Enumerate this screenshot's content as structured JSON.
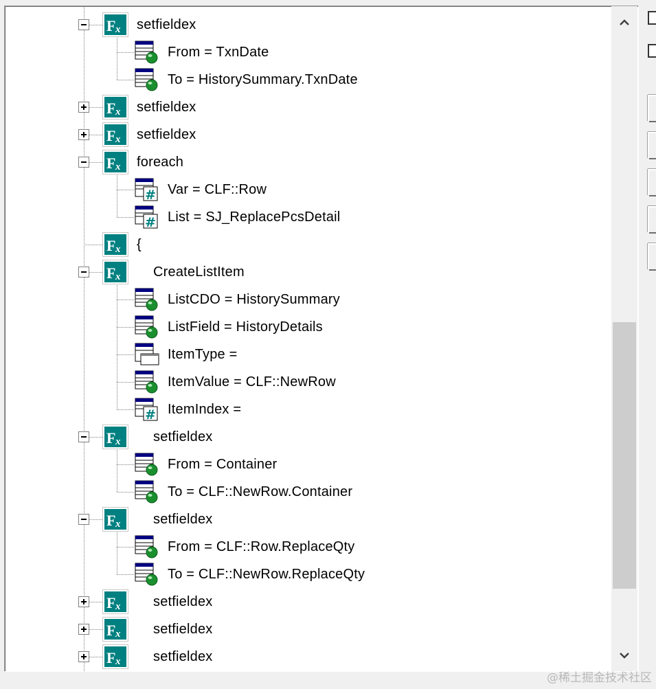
{
  "tree": {
    "rows": [
      {
        "label": "setfieldex",
        "icon": "function-icon",
        "expander": "minus"
      },
      {
        "label": "From = TxnDate",
        "icon": "table-globe-icon",
        "expander": ""
      },
      {
        "label": "To = HistorySummary.TxnDate",
        "icon": "table-globe-icon",
        "expander": ""
      },
      {
        "label": "setfieldex",
        "icon": "function-icon",
        "expander": "plus"
      },
      {
        "label": "setfieldex",
        "icon": "function-icon",
        "expander": "plus"
      },
      {
        "label": "foreach",
        "icon": "function-icon",
        "expander": "minus"
      },
      {
        "label": "Var = CLF::Row",
        "icon": "table-hash-icon",
        "expander": ""
      },
      {
        "label": "List = SJ_ReplacePcsDetail",
        "icon": "table-hash-icon",
        "expander": ""
      },
      {
        "label": "{",
        "icon": "function-icon",
        "expander": ""
      },
      {
        "label": "CreateListItem",
        "icon": "function-icon",
        "expander": "minus"
      },
      {
        "label": "ListCDO = HistorySummary",
        "icon": "table-globe-icon",
        "expander": ""
      },
      {
        "label": "ListField = HistoryDetails",
        "icon": "table-globe-icon",
        "expander": ""
      },
      {
        "label": "ItemType =",
        "icon": "table-window-icon",
        "expander": ""
      },
      {
        "label": "ItemValue = CLF::NewRow",
        "icon": "table-globe-icon",
        "expander": ""
      },
      {
        "label": "ItemIndex =",
        "icon": "table-hash-icon",
        "expander": ""
      },
      {
        "label": "setfieldex",
        "icon": "function-icon",
        "expander": "minus"
      },
      {
        "label": "From = Container",
        "icon": "table-globe-icon",
        "expander": ""
      },
      {
        "label": "To = CLF::NewRow.Container",
        "icon": "table-globe-icon",
        "expander": ""
      },
      {
        "label": "setfieldex",
        "icon": "function-icon",
        "expander": "minus"
      },
      {
        "label": "From = CLF::Row.ReplaceQty",
        "icon": "table-globe-icon",
        "expander": ""
      },
      {
        "label": "To = CLF::NewRow.ReplaceQty",
        "icon": "table-globe-icon",
        "expander": ""
      },
      {
        "label": "setfieldex",
        "icon": "function-icon",
        "expander": "plus"
      },
      {
        "label": "setfieldex",
        "icon": "function-icon",
        "expander": "plus"
      },
      {
        "label": "setfieldex",
        "icon": "function-icon",
        "expander": "plus"
      }
    ]
  },
  "colors": {
    "function_icon_bg": "#008080",
    "table_header": "#000080",
    "globe": "#1a8f2e"
  },
  "watermark": "@稀土掘金技术社区"
}
